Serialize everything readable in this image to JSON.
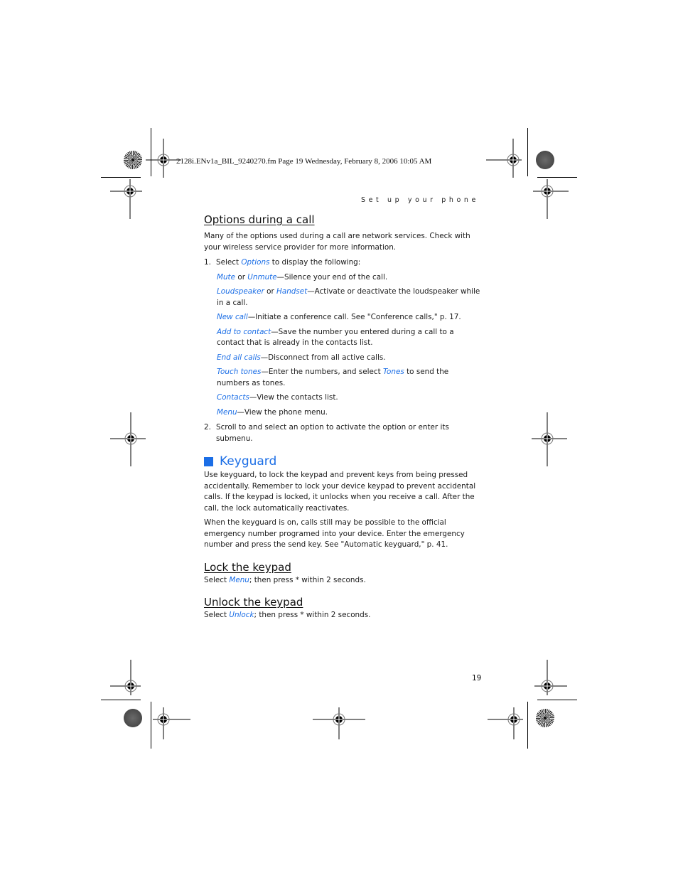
{
  "slug": "2128i.ENv1a_BIL_9240270.fm  Page 19  Wednesday, February 8, 2006  10:05 AM",
  "running_head": "Set up your phone",
  "colors": {
    "accent": "#1b6ee6"
  },
  "section_options": {
    "title": "Options during a call",
    "intro": "Many of the options used during a call are network services. Check with your wireless service provider for more information.",
    "step1": {
      "num": "1.",
      "pre": "Select ",
      "kw": "Options",
      "post": " to display the following:"
    },
    "options": [
      {
        "kw1": "Mute",
        "mid": " or ",
        "kw2": "Unmute",
        "desc": "—Silence your end of the call."
      },
      {
        "kw1": "Loudspeaker",
        "mid": " or ",
        "kw2": "Handset",
        "desc": "—Activate or deactivate the loudspeaker while in a call."
      },
      {
        "kw1": "New call",
        "desc": "—Initiate a conference call. See \"Conference calls,\" p. 17."
      },
      {
        "kw1": "Add to contact",
        "desc": "—Save the number you entered during a call to a contact that is already in the contacts list."
      },
      {
        "kw1": "End all calls",
        "desc": "—Disconnect from all active calls."
      },
      {
        "kw1": "Touch tones",
        "desc": "—Enter the numbers, and select ",
        "kw2": "Tones",
        "desc2": " to send the numbers as tones."
      },
      {
        "kw1": "Contacts",
        "desc": "—View the contacts list."
      },
      {
        "kw1": "Menu",
        "desc": "—View the phone menu."
      }
    ],
    "step2": {
      "num": "2.",
      "text": "Scroll to and select an option to activate the option or enter its submenu."
    }
  },
  "section_keyguard": {
    "title": "Keyguard",
    "para1": "Use keyguard, to lock the keypad and prevent keys from being pressed accidentally. Remember to lock your device keypad to prevent accidental calls. If the keypad is locked, it unlocks when you receive a call. After the call, the lock automatically reactivates.",
    "para2": "When the keyguard is on, calls still may be possible to the official emergency number programed into your device. Enter the emergency number and press the send key. See \"Automatic keyguard,\" p. 41."
  },
  "section_lock": {
    "title": "Lock the keypad",
    "pre": "Select ",
    "kw": "Menu",
    "post": "; then press * within 2 seconds."
  },
  "section_unlock": {
    "title": "Unlock the keypad",
    "pre": "Select ",
    "kw": "Unlock",
    "post": "; then press * within 2 seconds."
  },
  "page_number": "19"
}
